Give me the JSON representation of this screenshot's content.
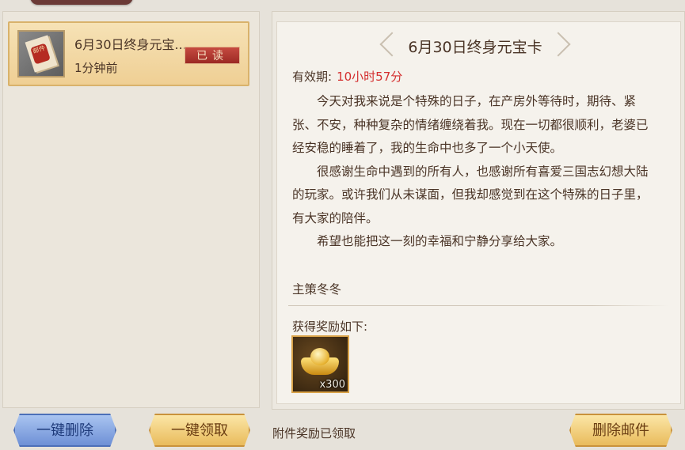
{
  "mail_list": {
    "items": [
      {
        "title": "6月30日终身元宝...",
        "time": "1分钟前",
        "status": "已读",
        "thumb_seal": "邮件",
        "icon": "mail-envelope-icon"
      }
    ]
  },
  "mail": {
    "heading": "6月30日终身元宝卡",
    "validity_label": "有效期:",
    "validity_value": "10小时57分",
    "paragraphs": [
      "今天对我来说是个特殊的日子，在产房外等待时，期待、紧张、不安，种种复杂的情绪缠绕着我。现在一切都很顺利，老婆已经安稳的睡着了，我的生命中也多了一个小天使。",
      "很感谢生命中遇到的所有人，也感谢所有喜爱三国志幻想大陆的玩家。或许我们从未谋面，但我却感觉到在这个特殊的日子里，有大家的陪伴。",
      "希望也能把这一刻的幸福和宁静分享给大家。"
    ],
    "signature": "主策冬冬",
    "reward_label": "获得奖励如下:",
    "rewards": [
      {
        "icon": "gold-ingot-icon",
        "count": "x300"
      }
    ]
  },
  "footer": {
    "delete_all_label": "一键删除",
    "claim_all_label": "一键领取",
    "claimed_status": "附件奖励已领取",
    "delete_mail_label": "删除邮件"
  },
  "colors": {
    "validity_value": "#d42f2f",
    "button_blue": "#6e90d6",
    "button_gold": "#e9bb5c",
    "read_badge": "#9c2a24"
  }
}
